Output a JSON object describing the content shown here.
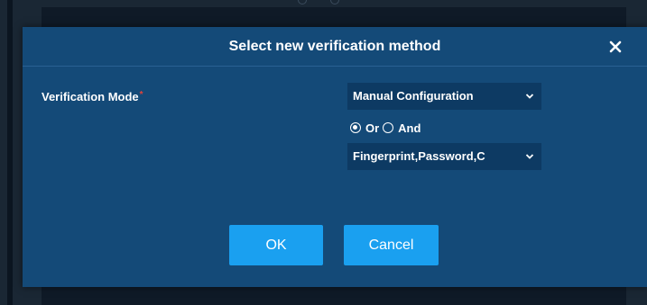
{
  "dialog": {
    "title": "Select new verification method",
    "close_icon": "close-icon"
  },
  "form": {
    "verification_mode_label": "Verification Mode",
    "required_mark": "*",
    "mode_select_value": "Manual Configuration",
    "logic_options": [
      {
        "label": "Or",
        "checked": true
      },
      {
        "label": "And",
        "checked": false
      }
    ],
    "methods_select_value": "Fingerprint,Password,C"
  },
  "buttons": {
    "ok_label": "OK",
    "cancel_label": "Cancel"
  },
  "colors": {
    "dialog_bg": "#144a78",
    "select_bg": "#0d3a63",
    "button_bg": "#1aa0f0",
    "required": "#e0433b"
  }
}
